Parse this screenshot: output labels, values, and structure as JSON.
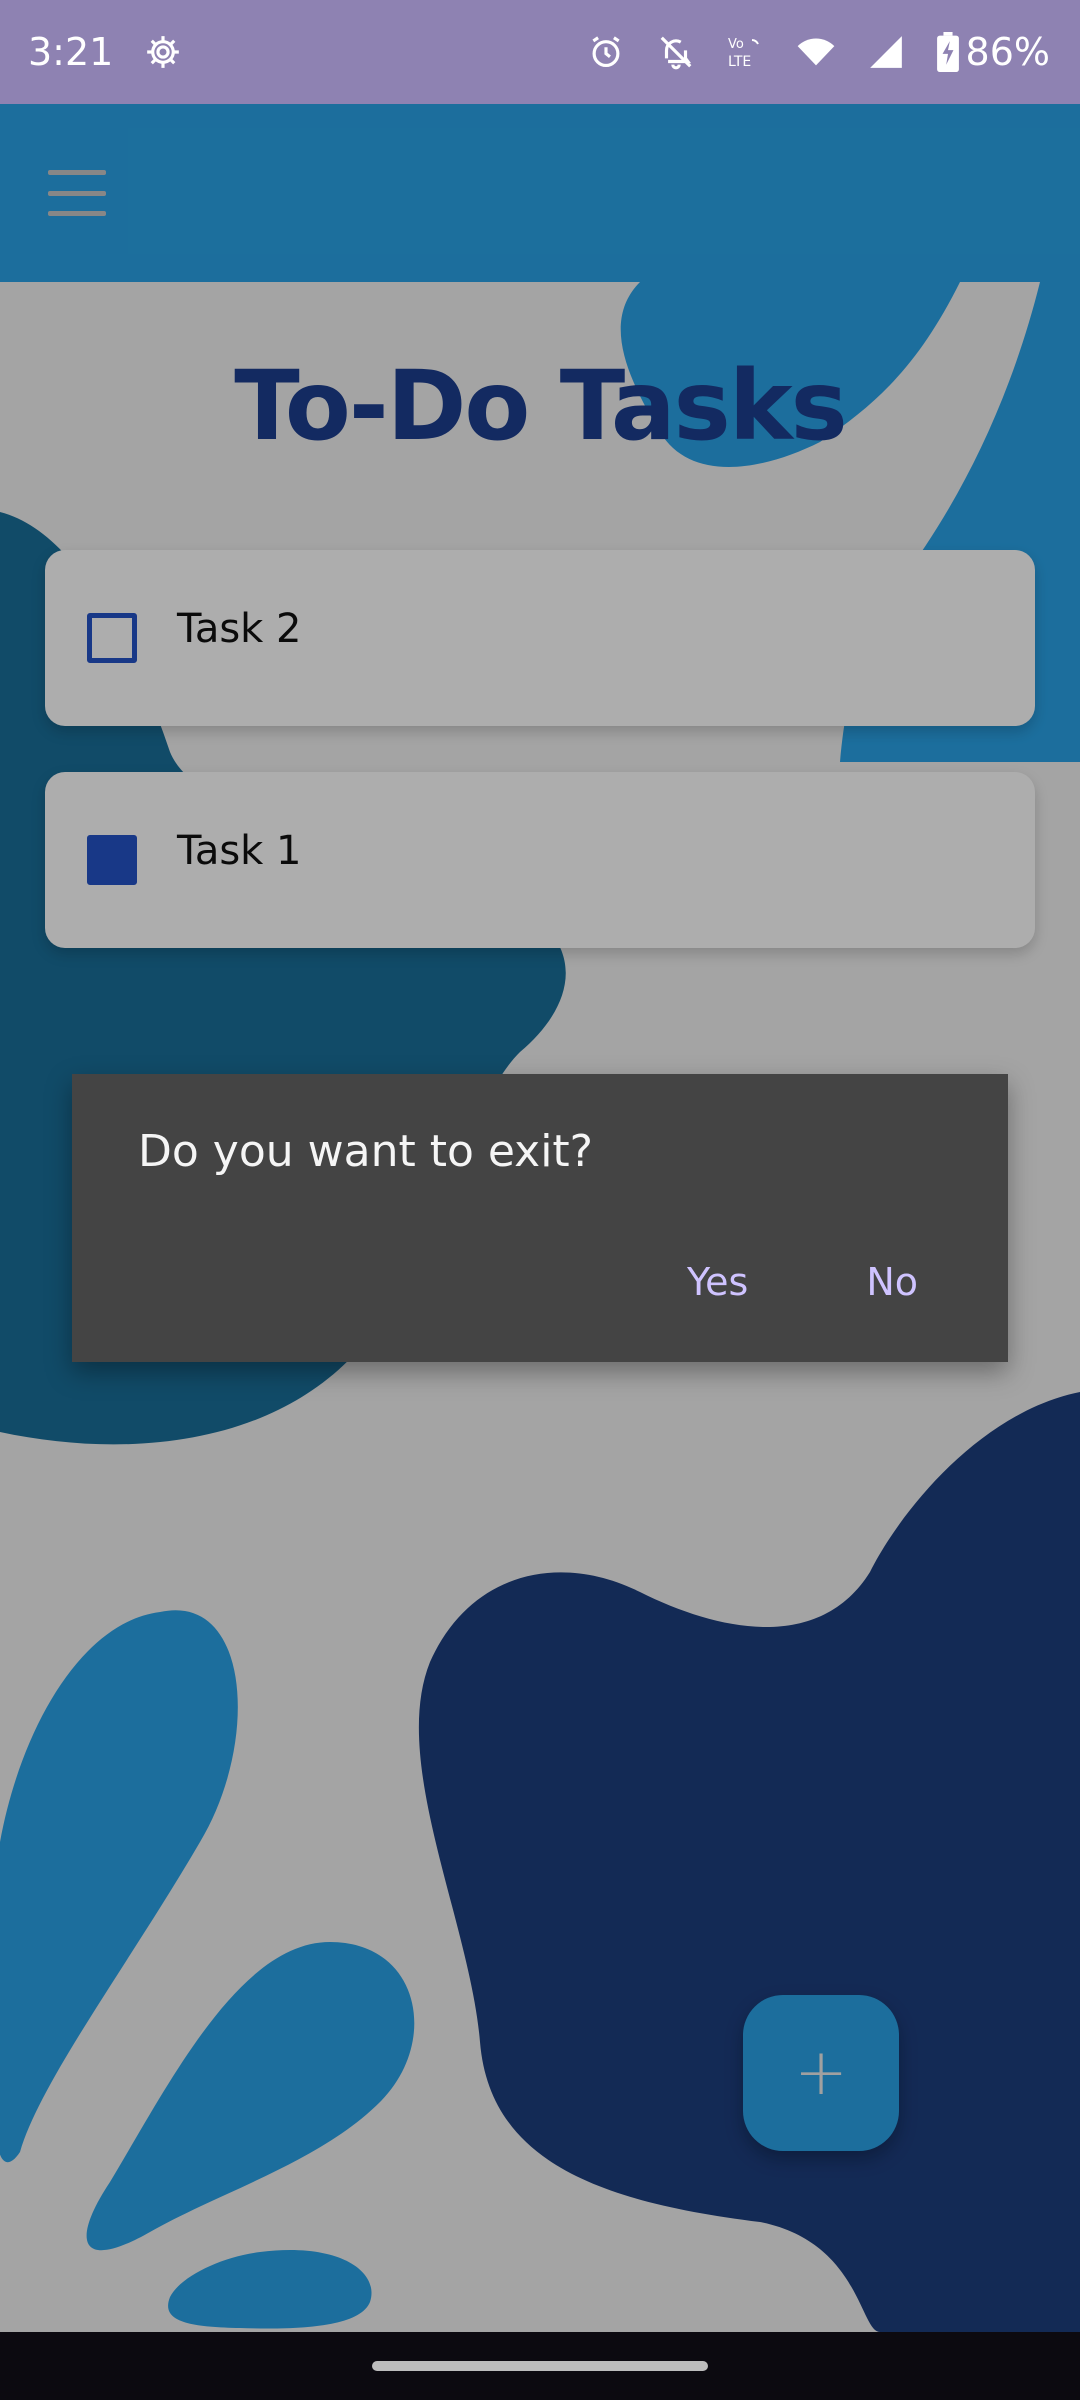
{
  "status_bar": {
    "time": "3:21",
    "battery": "86%",
    "icons": [
      "settings-icon",
      "alarm-icon",
      "notifications-off-icon",
      "volte-icon",
      "wifi-icon",
      "signal-icon",
      "battery-charging-icon"
    ],
    "lte_label_top": "Vo",
    "lte_label_bottom": "LTE"
  },
  "app_bar": {
    "menu_icon": "hamburger-menu-icon",
    "color": "#2aa3e8"
  },
  "page": {
    "title": "To-Do Tasks",
    "title_color": "#1d3f8f"
  },
  "tasks": [
    {
      "label": "Task 2",
      "checked": false
    },
    {
      "label": "Task 1",
      "checked": true
    }
  ],
  "dialog": {
    "message": "Do you want to exit?",
    "yes_label": "Yes",
    "no_label": "No"
  },
  "fab": {
    "icon": "plus-icon",
    "symbol": "+"
  },
  "colors": {
    "accent": "#2aa3e8",
    "dark_blue": "#1d3f8f",
    "dialog_bg": "#444444",
    "dialog_button": "#cfc3ff"
  }
}
